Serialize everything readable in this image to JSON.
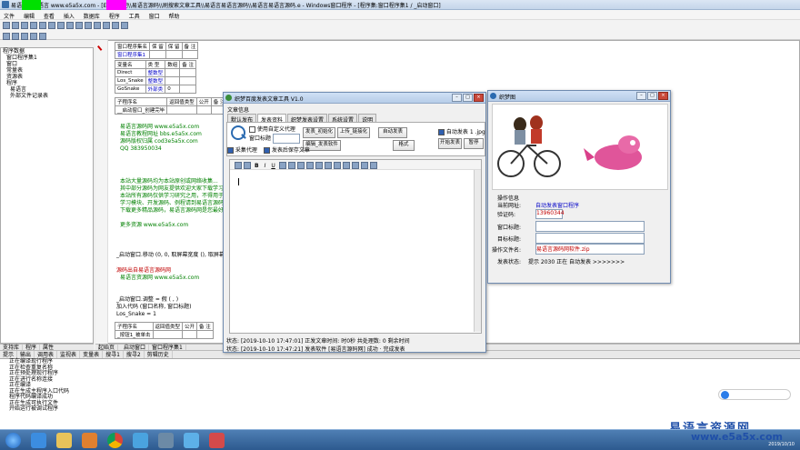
{
  "ide_title": "易语言 - 易语言 www.e5a5x.com - [E:\\\\100吧\\\\易语言源码\\\\刷搜索文章工具\\\\易语言易语言源码\\\\易语言易语言源码.e - Windows窗口程序 - [程序集:窗口程序集1 / _启动窗口]",
  "menu": [
    "文件",
    "编辑",
    "查看",
    "插入",
    "数据库",
    "程序",
    "工具",
    "窗口",
    "帮助"
  ],
  "left_tabs": [
    "支持库",
    "程序",
    "属性"
  ],
  "tree": [
    "程序数据",
    "窗口程序集1",
    "窗口",
    "常量表",
    "资源表",
    "程序",
    "易语言",
    "外部文件记录表"
  ],
  "code": {
    "table1": [
      [
        "窗口程序集名",
        "保 留",
        "保 留",
        "备 注"
      ],
      [
        "窗口程序集1",
        "",
        "",
        ""
      ]
    ],
    "vars": [
      [
        "变量名",
        "类 型",
        "数组",
        "备 注"
      ],
      [
        "Direct",
        "整数型",
        "",
        ""
      ],
      [
        "Los_Snake",
        "整数型",
        "",
        ""
      ],
      [
        "GoSnake",
        "外部类",
        "0",
        ""
      ]
    ],
    "sub_header": [
      "子程序名",
      "返回值类型",
      "公开",
      "备 注"
    ],
    "sub_name": "__启动窗口_创建完毕",
    "comments": [
      "易语言源码网   www.e5a5x.com",
      "易语言教程网址   bbs.e5a5x.com",
      "源码版权归属   cod3e5a5x.com",
      "QQ   383950034"
    ],
    "notes": [
      "本站大量源码均为本站原创或网络收集...",
      "其中部分源码为网友提供欢迎大家下载学习",
      "本站所有源码仅供学习研究之用，不得用于商业用途",
      "学习模块、开发源码、例程请到易语言源码网",
      "下载更多精品源码，易语言源码网是您最好的选择"
    ],
    "link": "更多资源   www.e5a5x.com",
    "call1": "_启动窗口.移动 (0, 0, 取屏幕宽度 (), 取屏幕高度 ())",
    "red": "源码出自易语言源码网",
    "red2": "易语言资源网   www.e5a5x.com",
    "lines": [
      "_启动窗口.调整 = 假  ( , )",
      "加入代码 (窗口名称, 窗口标题)",
      "Los_Snake = 1"
    ],
    "sub2_header": [
      "子程序名",
      "返回值类型",
      "公开",
      "备 注"
    ],
    "sub2_name": "_按钮1_被单击"
  },
  "editor_tabs": [
    "起始页",
    "_启动窗口",
    "窗口程序集1"
  ],
  "bottom_tabs": [
    "提示",
    "输出",
    "调用表",
    "监视表",
    "变量表",
    "搜寻1",
    "搜寻2",
    "剪辑历史"
  ],
  "output_lines": [
    "正在编译现行程序",
    "正在检查重复名称",
    "正在预处理现行程序",
    "正在进行名称连接",
    "正在编译",
    "正在生成主程序入口代码",
    "程序代码编译成功",
    "正在生成可执行文件",
    "开始运行被调试程序"
  ],
  "popup": {
    "title": "织梦百度发表文章工具 V1.0",
    "group": "文章信息",
    "tabs": [
      "默认发布",
      "发表资料",
      "织梦发表设置",
      "系统设置",
      "说明"
    ],
    "check_custom_proxy": "使用自定义代理",
    "window_title_label": "窗口标题",
    "btn_post_init": "发表_初始化",
    "btn_upload_proxy": "上传_链接化",
    "btn_auto_post": "自动发表",
    "btn_edit_content": "编辑_发表软件",
    "check_proxy_file": "采集代理",
    "check_save": "发表后保存文章",
    "check_auto_post": "自动发表 1 .jpg",
    "btn_format": "格式",
    "btn_open_dir": "开始发表",
    "btn_stop": "暂停",
    "editor_toolbar": [
      "B",
      "I",
      "U"
    ],
    "status1_label": "状态:",
    "status1": "[2019-10-10 17:47:01] 正发文章时间: 时0秒   共处理数: 0   剩余时间",
    "status2_label": "状态:",
    "status2": "[2019-10-10 17:47:21] 发表软件 [易语言源码网] 成功 · 完成发表"
  },
  "dialog": {
    "title": "织梦图",
    "group_label": "操作信息",
    "current_url_label": "当前网址:",
    "current_url": "自动发表窗口程序",
    "verify_label": "验证码:",
    "verify_value": "13960344",
    "window_title_label": "窗口标题:",
    "target_label": "目标标题:",
    "operate_file_label": "操作文件名:",
    "operate_file_value": "易语言源码网软件.zip",
    "post_status_label": "发表状态:",
    "post_status": "提示 2030 正在 自动发表 >>>>>>>"
  },
  "watermark": {
    "cn": "易语言资源网",
    "url": "www.e5a5x.com"
  },
  "clock": "2019/10/10",
  "colors": {
    "accent_green": "#00e000",
    "accent_magenta": "#ff00ff",
    "link_red": "#c00000"
  }
}
